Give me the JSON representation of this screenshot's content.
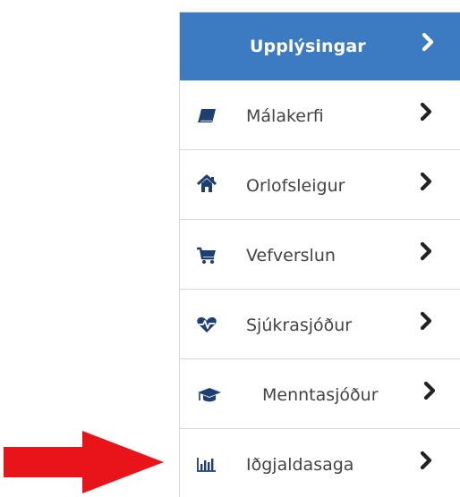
{
  "menu": {
    "header": {
      "label": "Upplýsingar",
      "icon": "chevron-right-icon",
      "color": "#3c7bc1"
    },
    "items": [
      {
        "label": "Málakerfi",
        "icon": "book-icon"
      },
      {
        "label": "Orlofsleigur",
        "icon": "home-icon"
      },
      {
        "label": "Vefverslun",
        "icon": "cart-icon"
      },
      {
        "label": "Sjúkrasjóður",
        "icon": "heartbeat-icon"
      },
      {
        "label": "Menntasjóður",
        "icon": "graduation-cap-icon"
      },
      {
        "label": "Iðgjaldasaga",
        "icon": "bar-chart-icon"
      }
    ]
  },
  "annotation": {
    "icon": "red-arrow-icon",
    "color": "#e8141a"
  }
}
